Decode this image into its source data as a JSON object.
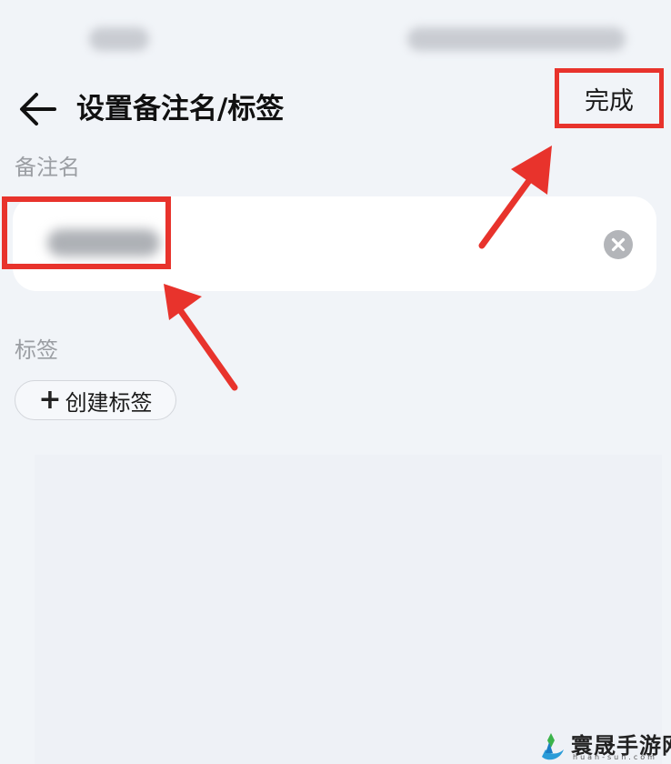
{
  "status_bar": {
    "time": "",
    "indicators": ""
  },
  "header": {
    "back_icon": "arrow-left-icon",
    "title": "设置备注名/标签",
    "done_label": "完成"
  },
  "remark": {
    "label": "备注名",
    "value": "",
    "clear_icon": "clear-circle-icon"
  },
  "tags": {
    "label": "标签",
    "create_icon": "plus-icon",
    "create_label": "创建标签"
  },
  "watermark": {
    "text": "寰晟手游网",
    "subtext": "huan-sun.com"
  },
  "colors": {
    "background": "#f1f4f8",
    "card": "#ffffff",
    "annotation_red": "#e8332c",
    "label_gray": "#9b9ea3"
  }
}
